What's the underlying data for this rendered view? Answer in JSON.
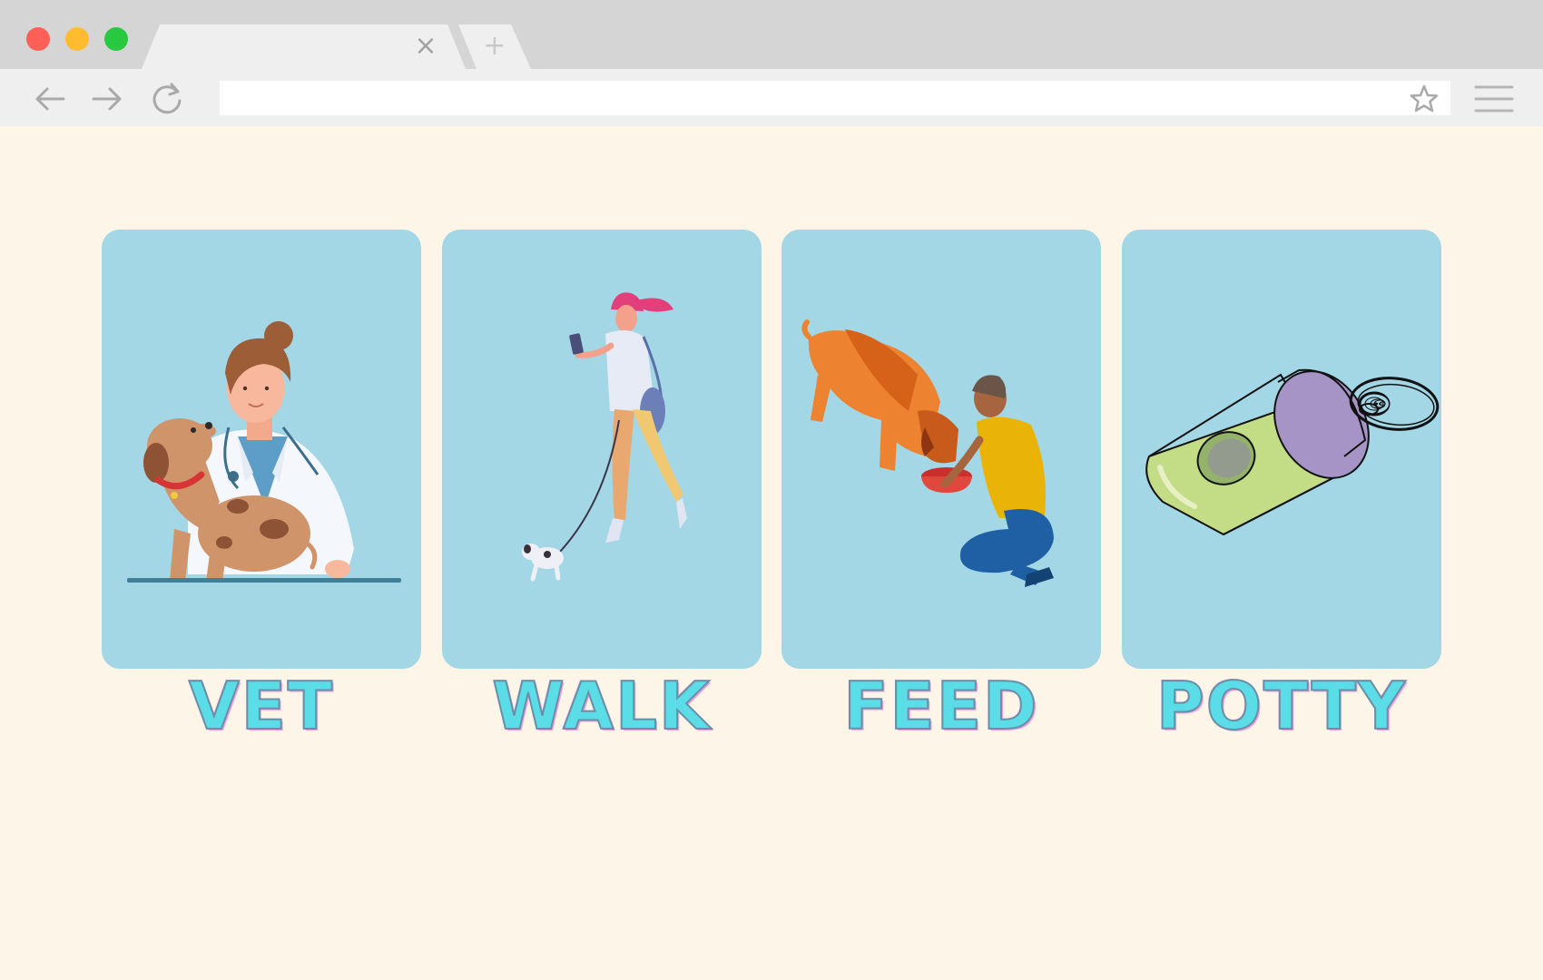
{
  "browser": {
    "active_tab_title": "",
    "close_tab_symbol": "×",
    "new_tab_symbol": "+",
    "address_value": "",
    "icons": [
      "back-arrow-icon",
      "forward-arrow-icon",
      "reload-icon",
      "star-icon",
      "hamburger-menu-icon"
    ]
  },
  "colors": {
    "page_background": "#fdf5e8",
    "card_background": "#a3d7e6",
    "label_fill": "#5adde6",
    "label_outline": "#f19ed9"
  },
  "cards": [
    {
      "label": "VET",
      "image": "veterinarian-with-dog-illustration"
    },
    {
      "label": "WALK",
      "image": "woman-walking-dog-illustration"
    },
    {
      "label": "FEED",
      "image": "man-feeding-dog-illustration"
    },
    {
      "label": "POTTY",
      "image": "poop-bag-dispenser-illustration"
    }
  ]
}
